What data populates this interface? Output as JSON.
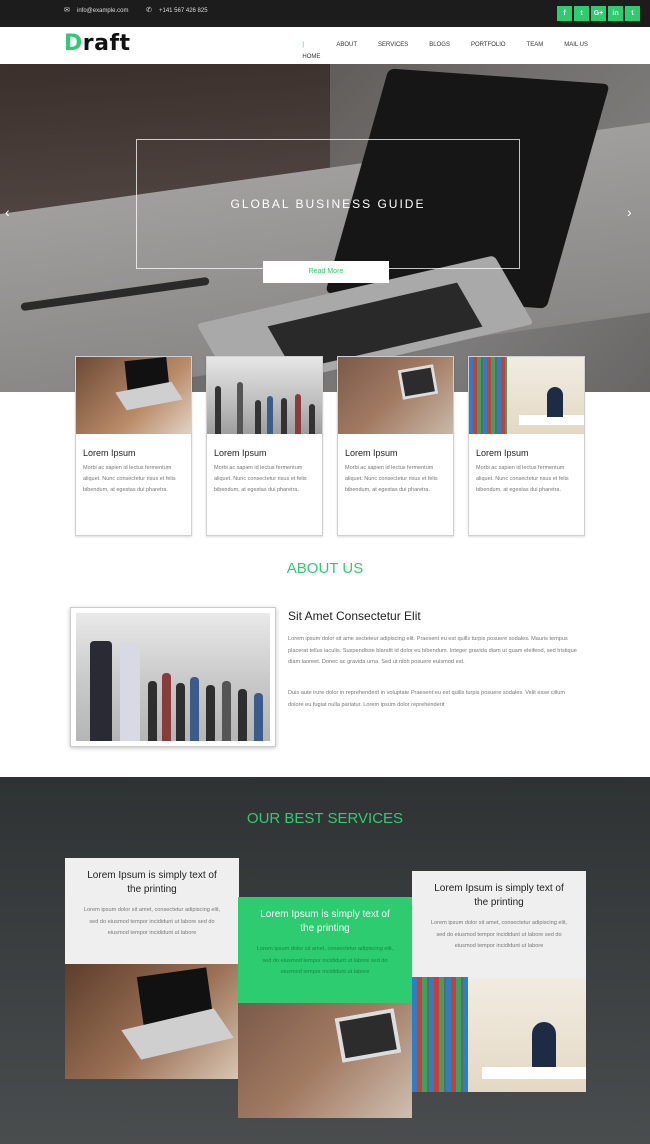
{
  "topbar": {
    "email": "info@example.com",
    "phone": "+141 567 426 825",
    "social": [
      "f",
      "t",
      "G+",
      "in",
      "t"
    ]
  },
  "nav": {
    "logo": "Draft",
    "logo_first": "D",
    "logo_rest": "raft",
    "items": [
      "HOME",
      "ABOUT",
      "SERVICES",
      "BLOGS",
      "PORTFOLIO",
      "TEAM",
      "MAIL US"
    ]
  },
  "hero": {
    "title": "GLOBAL BUSINESS GUIDE",
    "button": "Read More",
    "prev": "‹",
    "next": "›"
  },
  "cards": [
    {
      "title": "Lorem Ipsum",
      "text": "Morbi ac sapien id lectus fermentum aliquet. Nunc consectetur risus et felis bibendum, at egestas dui pharetra."
    },
    {
      "title": "Lorem Ipsum",
      "text": "Morbi ac sapien id lectus fermentum aliquet. Nunc consectetur risus et felis bibendum, at egestas dui pharetra."
    },
    {
      "title": "Lorem Ipsum",
      "text": "Morbi ac sapien id lectus fermentum aliquet. Nunc consectetur risus et felis bibendum, at egestas dui pharetra."
    },
    {
      "title": "Lorem Ipsum",
      "text": "Morbi ac sapien id lectus fermentum aliquet. Nunc consectetur risus et felis bibendum, at egestas dui pharetra."
    }
  ],
  "about": {
    "title": "ABOUT US",
    "heading": "Sit Amet Consectetur Elit",
    "para1": "Lorem ipsum dolor sit ame secteteur adipiscing elit. Praesent eu est quills turpis posuere sodales. Mauris tempus placerat tellus iaculis. Suspendisse blandit id dolor eu bibendum. Integer gravida diam ut quam eleifend, sed tristique diam laoreet. Donec ac gravida urna. Sed ut nibh posuere euismod est.",
    "para2": "Duis aute irure dolor in reprehenderit in voluptate Praesent eu est quills turpis posuere sodales. Velit esse cillum dolore eu fugiat nulla pariatur. Lorem ipsum dolor reprehenderit"
  },
  "services": {
    "title": "OUR BEST SERVICES",
    "items": [
      {
        "title": "Lorem Ipsum is simply text of the printing",
        "text": "Lorem ipsum dolor sit amet, consectetur adipiscing elit, sed do eiusmod tempor incididunt ut labore sed do eiusmod tempor incididunt ut labore"
      },
      {
        "title": "Lorem Ipsum is simply text of the printing",
        "text": "Lorem ipsum dolor sit amet, consectetur adipiscing elit, sed do eiusmod tempor incididunt ut labore sed do eiusmod tempor incididunt ut labore"
      },
      {
        "title": "Lorem Ipsum is simply text of the printing",
        "text": "Lorem ipsum dolor sit amet, consectetur adipiscing elit, sed do eiusmod tempor incididunt ut labore sed do eiusmod tempor incididunt ut labore"
      }
    ]
  },
  "colors": {
    "accent": "#2ecc71",
    "topbar": "#1c1c1c",
    "services_bg": "#3a3d3e"
  }
}
